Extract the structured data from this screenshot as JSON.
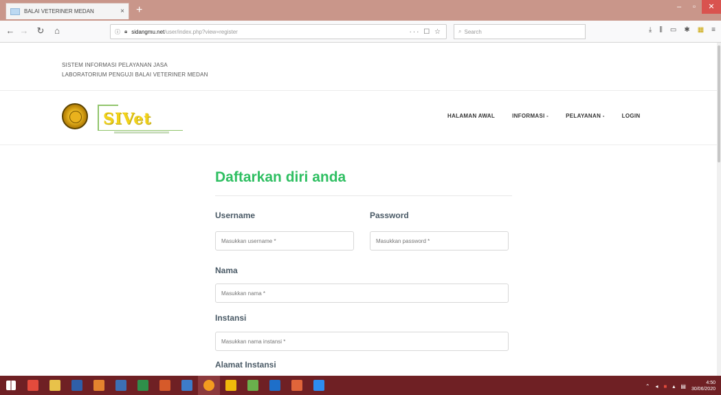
{
  "browser": {
    "tab_title": "BALAI VETERINER MEDAN",
    "tab_close": "×",
    "new_tab": "+",
    "url_host": "sidangmu.net",
    "url_path": "/user/index.php?view=register",
    "url_actions": "··· ☐ ☆",
    "search_placeholder": "Search",
    "win_min": "–",
    "win_max": "▫",
    "win_close": "✕"
  },
  "header": {
    "info_line1": "SISTEM INFORMASI PELAYANAN JASA",
    "info_line2": "LABORATORIUM PENGUJI BALAI VETERINER MEDAN",
    "logo_text": "SIVet"
  },
  "menu": {
    "items": [
      "HALAMAN AWAL",
      "INFORMASI -",
      "PELAYANAN -",
      "LOGIN"
    ]
  },
  "form": {
    "title": "Daftarkan diri anda",
    "username_label": "Username",
    "username_placeholder": "Masukkan username *",
    "password_label": "Password",
    "password_placeholder": "Masukkan password *",
    "nama_label": "Nama",
    "nama_placeholder": "Masukkan nama *",
    "instansi_label": "Instansi",
    "instansi_placeholder": "Masukkan nama instansi *",
    "alamat_label": "Alamat Instansi"
  },
  "taskbar": {
    "time": "4:50",
    "date": "30/06/2020"
  },
  "colors": {
    "accent_green": "#2fbf62",
    "tab_bar": "#c9968a",
    "taskbar": "#6f2024"
  }
}
